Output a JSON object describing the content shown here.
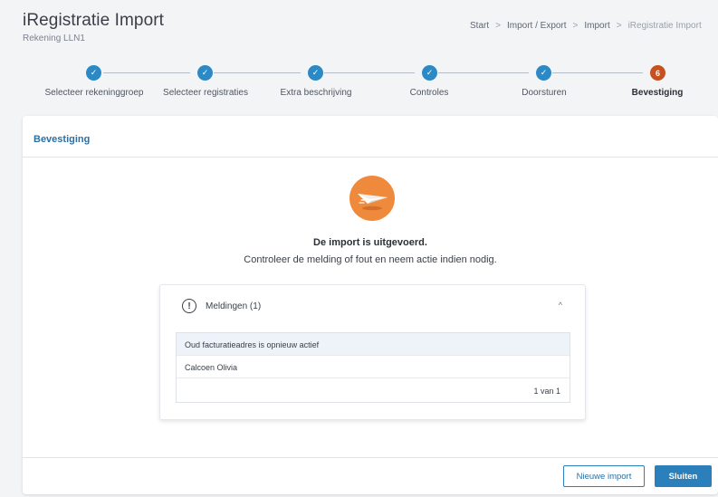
{
  "header": {
    "title": "iRegistratie Import",
    "subtitle": "Rekening LLN1"
  },
  "breadcrumb": {
    "items": [
      "Start",
      "Import / Export",
      "Import",
      "iRegistratie Import"
    ],
    "separator": ">"
  },
  "stepper": {
    "steps": [
      {
        "label": "Selecteer rekeninggroep",
        "status": "done",
        "marker": "✓"
      },
      {
        "label": "Selecteer registraties",
        "status": "done",
        "marker": "✓"
      },
      {
        "label": "Extra beschrijving",
        "status": "done",
        "marker": "✓"
      },
      {
        "label": "Controles",
        "status": "done",
        "marker": "✓"
      },
      {
        "label": "Doorsturen",
        "status": "done",
        "marker": "✓"
      },
      {
        "label": "Bevestiging",
        "status": "active",
        "marker": "6"
      }
    ]
  },
  "card": {
    "title": "Bevestiging",
    "done_title": "De import is uitgevoerd.",
    "done_text": "Controleer de melding of fout en neem actie indien nodig.",
    "illustration_icon": "paper-plane-icon"
  },
  "messages": {
    "title": "Meldingen (1)",
    "rows": [
      "Oud facturatieadres is opnieuw actief",
      "Calcoen Olivia"
    ],
    "pagination": "1 van 1"
  },
  "footer": {
    "new_import_label": "Nieuwe import",
    "close_label": "Sluiten"
  },
  "colors": {
    "accent": "#2b7fbb",
    "active_step": "#c84f1f",
    "illustration": "#ef8a3c"
  }
}
